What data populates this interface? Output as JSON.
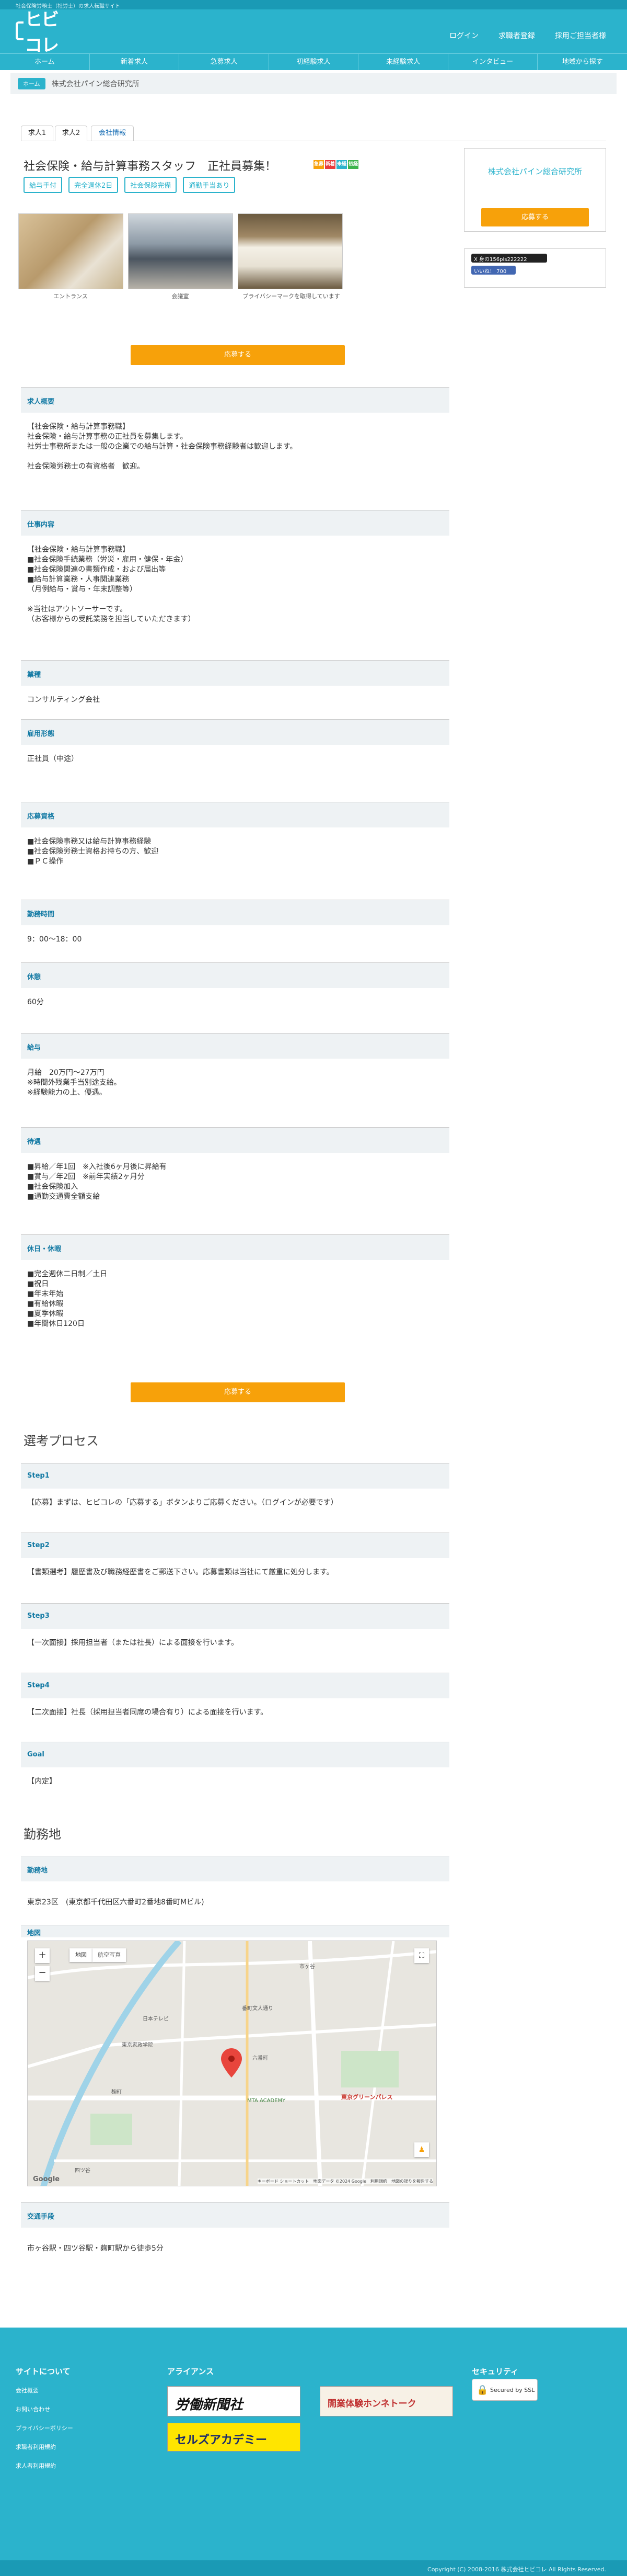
{
  "topbar": {
    "text": "社会保険労務士（社労士）の求人転職サイト"
  },
  "header": {
    "logo": "ヒビコレ",
    "nav": [
      "ログイン",
      "求職者登録",
      "採用ご担当者様"
    ]
  },
  "menu": [
    "ホーム",
    "新着求人",
    "急募求人",
    "初経験求人",
    "未経験求人",
    "インタビュー",
    "地域から探す"
  ],
  "breadcrumb": {
    "home": "ホーム",
    "current": "株式会社パイン総合研究所"
  },
  "tabs": [
    "求人1",
    "求人2",
    "会社情報"
  ],
  "job": {
    "title": "社会保険・給与計算事務スタッフ　正社員募集！",
    "badges": [
      "急募",
      "新着",
      "未経験",
      "初経験"
    ],
    "tags": [
      "給与手付",
      "完全週休2日",
      "社会保険完備",
      "通勤手当あり"
    ],
    "photos": [
      "エントランス",
      "会議室",
      "プライバシーマークを取得しています"
    ]
  },
  "sidebar": {
    "company": "株式会社パイン総合研究所",
    "apply": "応募する",
    "share": "X 身の156pls222222",
    "like": "いいね！ 700"
  },
  "apply_button": "応募する",
  "sections": [
    {
      "head": "求人概要",
      "lines": [
        "【社会保険・給与計算事務職】",
        "社会保険・給与計算事務の正社員を募集します。",
        "社労士事務所または一般の企業での給与計算・社会保険事務経験者は歓迎します。",
        "",
        "社会保険労務士の有資格者　歓迎。"
      ]
    },
    {
      "head": "仕事内容",
      "lines": [
        "【社会保険・給与計算事務職】",
        "■社会保険手続業務（労災・雇用・健保・年金）",
        "■社会保険関連の書類作成・および届出等",
        "■給与計算業務・人事関連業務",
        "（月例給与・賞与・年末調整等）",
        "",
        "※当社はアウトソーサーです。",
        "（お客様からの受託業務を担当していただきます）"
      ]
    },
    {
      "head": "業種",
      "lines": [
        "コンサルティング会社"
      ]
    },
    {
      "head": "雇用形態",
      "lines": [
        "正社員（中途）"
      ]
    },
    {
      "head": "応募資格",
      "lines": [
        "■社会保険事務又は給与計算事務経験",
        "■社会保険労務士資格お持ちの方、歓迎",
        "■ＰＣ操作"
      ]
    },
    {
      "head": "勤務時間",
      "lines": [
        "9：00〜18：00"
      ]
    },
    {
      "head": "休憩",
      "lines": [
        "60分"
      ]
    },
    {
      "head": "給与",
      "lines": [
        "月給　20万円〜27万円",
        "※時間外残業手当別途支給。",
        "※経験能力の上、優遇。"
      ]
    },
    {
      "head": "待遇",
      "lines": [
        "■昇給／年1回　※入社後6ヶ月後に昇給有",
        "■賞与／年2回　※前年実績2ヶ月分",
        "■社会保険加入",
        "■通勤交通費全額支給"
      ]
    },
    {
      "head": "休日・休暇",
      "lines": [
        "■完全週休二日制／土日",
        "■祝日",
        "■年末年始",
        "■有給休暇",
        "■夏季休暇",
        "■年間休日120日"
      ]
    }
  ],
  "selection": {
    "title": "選考プロセス",
    "steps": [
      {
        "head": "Step1",
        "text": "【応募】まずは、ヒビコレの「応募する」ボタンよりご応募ください。（ログインが必要です）"
      },
      {
        "head": "Step2",
        "text": "【書類選考】履歴書及び職務経歴書をご郵送下さい。応募書類は当社にて厳重に処分します。"
      },
      {
        "head": "Step3",
        "text": "【一次面接】採用担当者（または社長）による面接を行います。"
      },
      {
        "head": "Step4",
        "text": "【二次面接】社長（採用担当者同席の場合有り）による面接を行います。"
      },
      {
        "head": "Goal",
        "text": "【内定】"
      }
    ]
  },
  "workplace": {
    "title": "勤務地",
    "location_head": "勤務地",
    "address": "東京23区　(東京都千代田区六番町2番地8番町Mビル)",
    "map_head": "地図",
    "map": {
      "tab_map": "地図",
      "tab_sat": "航空写真",
      "labels": [
        "麹町",
        "四ツ谷",
        "市ヶ谷",
        "番町文人通り",
        "六番町",
        "東京グリーンパレス",
        "MTA ACADEMY",
        "日本テレビ",
        "東京家政学院"
      ],
      "footer": "キーボード ショートカット　地図データ ©2024 Google　利用規約　地図の誤りを報告する"
    },
    "access_head": "交通手段",
    "access": "市ヶ谷駅・四ツ谷駅・麹町駅から徒歩5分"
  },
  "footer": {
    "site_head": "サイトについて",
    "site_links": [
      "会社概要",
      "お問い合わせ",
      "プライバシーポリシー",
      "求職者利用規約",
      "求人者利用規約"
    ],
    "alliance_head": "アライアンス",
    "banners": [
      "労働新聞社",
      "開業体験ホンネトーク",
      "セルズアカデミー"
    ],
    "security_head": "セキュリティ",
    "ssl": "Secured by SSL",
    "copyright": "Copyright (C) 2008-2016 株式会社ヒビコレ All Rights Reserved."
  }
}
